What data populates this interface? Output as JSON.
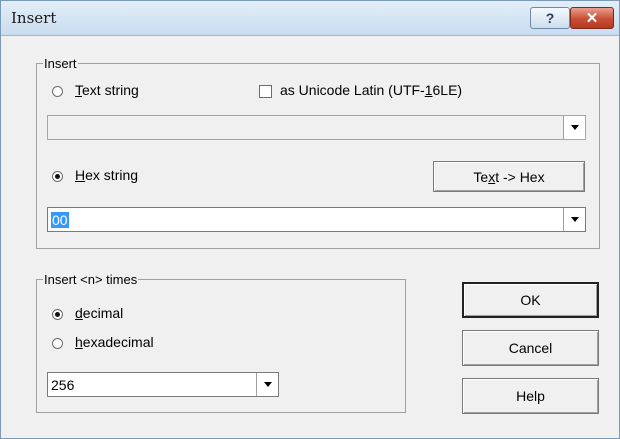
{
  "window": {
    "title": "Insert",
    "help_glyph": "?",
    "close_glyph": "✕"
  },
  "insert_group": {
    "legend": "Insert",
    "text_string": {
      "label_accel": "T",
      "label_rest": "ext string",
      "selected": false
    },
    "unicode_checkbox": {
      "label_pre": "as Unicode Latin (UTF-",
      "label_accel": "1",
      "label_post": "6LE)",
      "checked": false
    },
    "text_combo": {
      "value": "",
      "enabled": false
    },
    "hex_string": {
      "label_accel": "H",
      "label_rest": "ex string",
      "selected": true
    },
    "text_to_hex_button": {
      "label_pre": "Te",
      "label_accel": "x",
      "label_post": "t -> Hex"
    },
    "hex_combo": {
      "value": "00",
      "text_selected": true
    }
  },
  "times_group": {
    "legend": "Insert <n> times",
    "decimal": {
      "label_accel": "d",
      "label_rest": "ecimal",
      "selected": true
    },
    "hexadecimal": {
      "label_accel": "h",
      "label_rest": "exadecimal",
      "selected": false
    },
    "count_combo": {
      "value": "256"
    }
  },
  "buttons": {
    "ok": "OK",
    "cancel": "Cancel",
    "help": "Help"
  }
}
